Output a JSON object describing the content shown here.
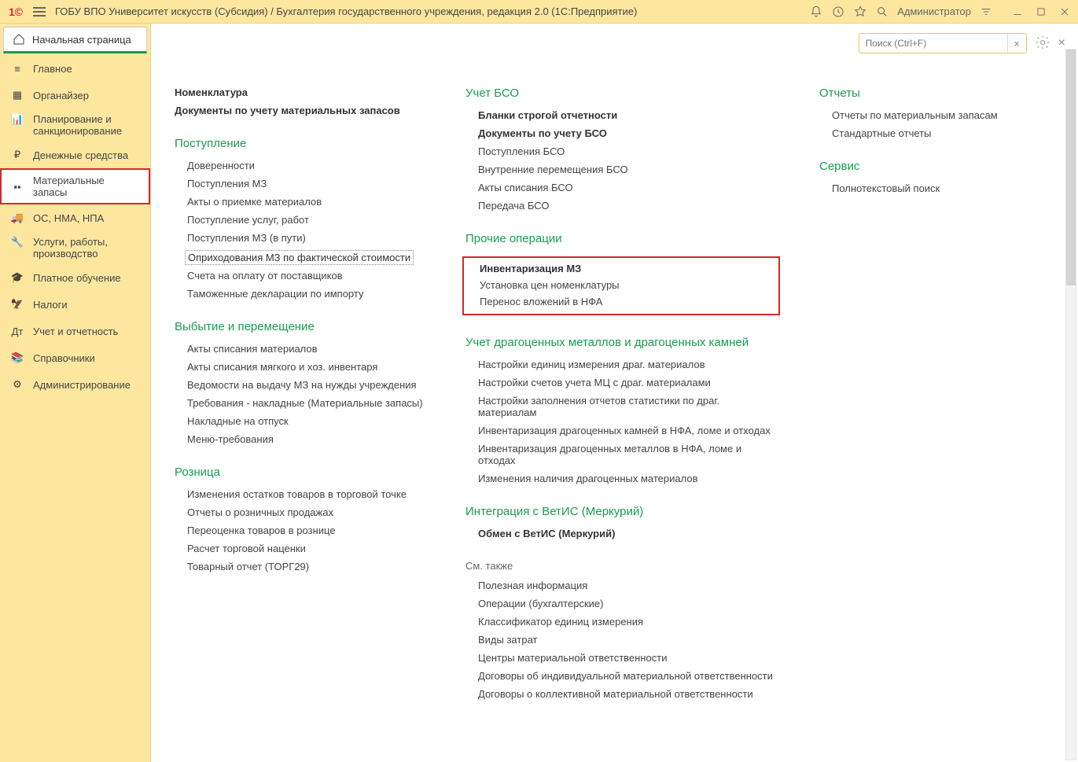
{
  "titlebar": {
    "title": "ГОБУ ВПО Университет искусств (Субсидия) / Бухгалтерия государственного учреждения, редакция 2.0  (1С:Предприятие)",
    "user": "Администратор"
  },
  "sidebar": {
    "home": "Начальная страница",
    "items": [
      "Главное",
      "Органайзер",
      "Планирование и санкционирование",
      "Денежные средства",
      "Материальные запасы",
      "ОС, НМА, НПА",
      "Услуги, работы, производство",
      "Платное обучение",
      "Налоги",
      "Учет и отчетность",
      "Справочники",
      "Администрирование"
    ]
  },
  "search": {
    "placeholder": "Поиск (Ctrl+F)"
  },
  "col1": {
    "nomenclature": "Номенклатура",
    "docs_mz": "Документы по учету материальных запасов",
    "incoming": "Поступление",
    "incoming_items": [
      "Доверенности",
      "Поступления МЗ",
      "Акты о приемке материалов",
      "Поступление услуг, работ",
      "Поступления МЗ (в пути)"
    ],
    "incoming_dotted": "Оприходования МЗ по фактической стоимости",
    "incoming_after": [
      "Счета на оплату от поставщиков",
      "Таможенные декларации по импорту"
    ],
    "disposal": "Выбытие и перемещение",
    "disposal_items": [
      "Акты списания материалов",
      "Акты списания мягкого и хоз. инвентаря",
      "Ведомости на выдачу МЗ на нужды учреждения",
      "Требования - накладные (Материальные запасы)",
      "Накладные на отпуск",
      "Меню-требования"
    ],
    "retail": "Розница",
    "retail_items": [
      "Изменения остатков товаров в торговой точке",
      "Отчеты о розничных продажах",
      "Переоценка товаров в рознице",
      "Расчет торговой наценки",
      "Товарный отчет (ТОРГ29)"
    ]
  },
  "col2": {
    "bso": "Учет БСО",
    "bso_bold1": "Бланки строгой отчетности",
    "bso_bold2": "Документы по учету БСО",
    "bso_items": [
      "Поступления БСО",
      "Внутренние перемещения БСО",
      "Акты списания БСО",
      "Передача БСО"
    ],
    "other": "Прочие операции",
    "other_bold": "Инвентаризация МЗ",
    "other_items": [
      "Установка цен номенклатуры",
      "Перенос вложений в НФА"
    ],
    "precious": "Учет драгоценных металлов и драгоценных камней",
    "precious_items": [
      "Настройки единиц измерения драг. материалов",
      "Настройки счетов учета МЦ с драг. материалами",
      "Настройки заполнения отчетов статистики по драг. материалам",
      "Инвентаризация драгоценных камней в НФА, ломе и отходах",
      "Инвентаризация драгоценных металлов в НФА, ломе и отходах",
      "Изменения наличия драгоценных материалов"
    ],
    "vetis": "Интеграция с ВетИС (Меркурий)",
    "vetis_bold": "Обмен с ВетИС (Меркурий)",
    "see_also": "См. также",
    "see_also_items": [
      "Полезная информация",
      "Операции (бухгалтерские)",
      "Классификатор единиц измерения",
      "Виды затрат",
      "Центры материальной ответственности",
      "Договоры об индивидуальной материальной ответственности",
      "Договоры о коллективной материальной ответственности"
    ]
  },
  "col3": {
    "reports": "Отчеты",
    "reports_items": [
      "Отчеты по материальным запасам",
      "Стандартные отчеты"
    ],
    "service": "Сервис",
    "service_items": [
      "Полнотекстовый поиск"
    ]
  }
}
